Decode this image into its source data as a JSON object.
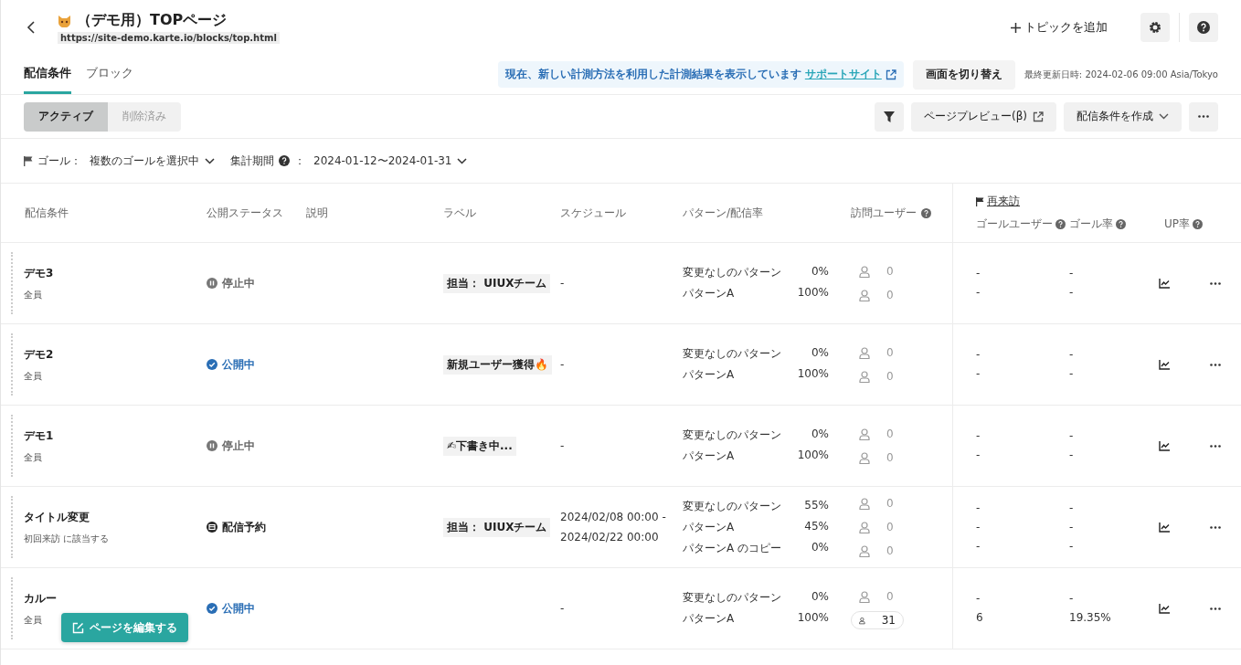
{
  "header": {
    "title": "（デモ用）TOPページ",
    "url": "https://site-demo.karte.io/blocks/top.html",
    "add_topic": "トピックを追加"
  },
  "tabs": [
    {
      "label": "配信条件",
      "selected": true
    },
    {
      "label": "ブロック",
      "selected": false
    }
  ],
  "notice": {
    "text": "現在、新しい計測方法を利用した計測結果を表示しています",
    "link": "サポートサイト"
  },
  "switch_button": "画面を切り替え",
  "last_updated": "最終更新日時: 2024-02-06 09:00 Asia/Tokyo",
  "segments": [
    {
      "label": "アクティブ",
      "selected": true
    },
    {
      "label": "削除済み",
      "selected": false
    }
  ],
  "toolbar": {
    "preview": "ページプレビュー(β)",
    "create": "配信条件を作成"
  },
  "filters": {
    "goal_label": "ゴール：",
    "goal_value": "複数のゴールを選択中",
    "period_label": "集計期間",
    "period_sep": "：",
    "period_value": "2024-01-12〜2024-01-31"
  },
  "columns": [
    {
      "label": "配信条件",
      "help": false
    },
    {
      "label": "公開ステータス",
      "help": false
    },
    {
      "label": "説明",
      "help": false
    },
    {
      "label": "ラベル",
      "help": false
    },
    {
      "label": "スケジュール",
      "help": false
    },
    {
      "label": "パターン/配信率",
      "help": false
    },
    {
      "label": "訪問ユーザー",
      "help": true
    }
  ],
  "goal_group": "再来訪",
  "goal_columns": [
    {
      "label": "ゴールユーザー",
      "help": true
    },
    {
      "label": "ゴール率",
      "help": true
    },
    {
      "label": "UP率",
      "help": true
    }
  ],
  "rows": [
    {
      "name": "デモ3",
      "target": "全員",
      "status": {
        "kind": "paused",
        "text": "停止中"
      },
      "label": "担当： UIUXチーム",
      "schedule": [
        "-"
      ],
      "patterns": [
        {
          "name": "変更なしのパターン",
          "rate": "0%",
          "users": "0",
          "highlighted": false
        },
        {
          "name": "パターンA",
          "rate": "100%",
          "users": "0",
          "highlighted": false
        }
      ],
      "goal_users": [
        "-",
        "-"
      ],
      "goal_rates": [
        "-",
        "-"
      ]
    },
    {
      "name": "デモ2",
      "target": "全員",
      "status": {
        "kind": "public",
        "text": "公開中"
      },
      "label": "新規ユーザー獲得🔥",
      "schedule": [
        "-"
      ],
      "patterns": [
        {
          "name": "変更なしのパターン",
          "rate": "0%",
          "users": "0",
          "highlighted": false
        },
        {
          "name": "パターンA",
          "rate": "100%",
          "users": "0",
          "highlighted": false
        }
      ],
      "goal_users": [
        "-",
        "-"
      ],
      "goal_rates": [
        "-",
        "-"
      ]
    },
    {
      "name": "デモ1",
      "target": "全員",
      "status": {
        "kind": "paused",
        "text": "停止中"
      },
      "label": "✍下書き中...",
      "schedule": [
        "-"
      ],
      "patterns": [
        {
          "name": "変更なしのパターン",
          "rate": "0%",
          "users": "0",
          "highlighted": false
        },
        {
          "name": "パターンA",
          "rate": "100%",
          "users": "0",
          "highlighted": false
        }
      ],
      "goal_users": [
        "-",
        "-"
      ],
      "goal_rates": [
        "-",
        "-"
      ]
    },
    {
      "name": "タイトル変更",
      "target": "初回来訪 に該当する",
      "status": {
        "kind": "scheduled",
        "text": "配信予約"
      },
      "label": "担当： UIUXチーム",
      "schedule": [
        "2024/02/08 00:00 -",
        "2024/02/22 00:00"
      ],
      "patterns": [
        {
          "name": "変更なしのパターン",
          "rate": "55%",
          "users": "0",
          "highlighted": false
        },
        {
          "name": "パターンA",
          "rate": "45%",
          "users": "0",
          "highlighted": false
        },
        {
          "name": "パターンA のコピー",
          "rate": "0%",
          "users": "0",
          "highlighted": false
        }
      ],
      "goal_users": [
        "-",
        "-",
        "-"
      ],
      "goal_rates": [
        "-",
        "-",
        "-"
      ]
    },
    {
      "name": "カルー",
      "target": "全員",
      "status": {
        "kind": "public",
        "text": "公開中"
      },
      "label": "",
      "schedule": [
        "-"
      ],
      "patterns": [
        {
          "name": "変更なしのパターン",
          "rate": "0%",
          "users": "0",
          "highlighted": false
        },
        {
          "name": "パターンA",
          "rate": "100%",
          "users": "31",
          "highlighted": true
        }
      ],
      "goal_users": [
        "-",
        "6"
      ],
      "goal_rates": [
        "-",
        "19.35%"
      ]
    }
  ],
  "edit_button": "ページを編集する"
}
